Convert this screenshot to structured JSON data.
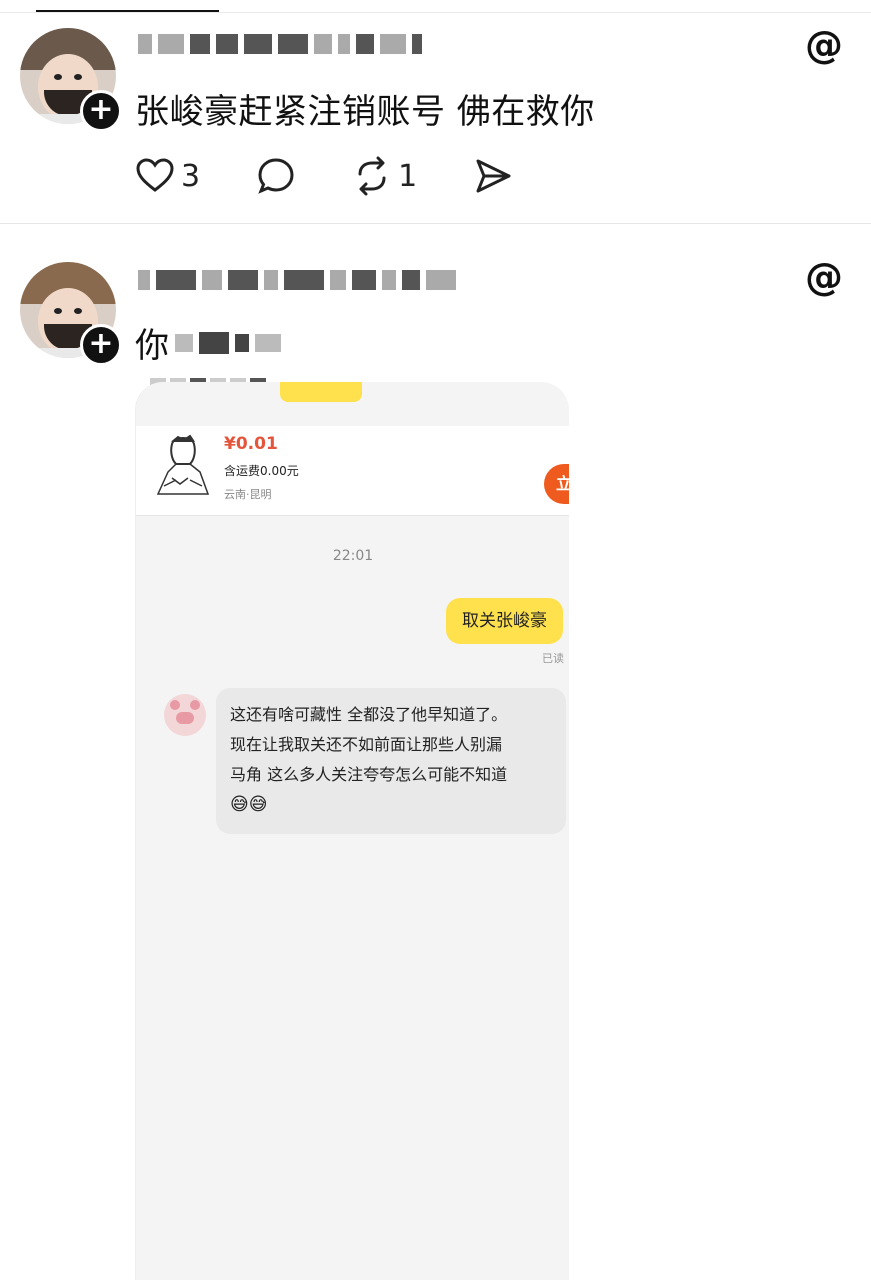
{
  "posts": [
    {
      "text": "张峻豪赶紧注销账号 佛在救你",
      "follow_symbol": "+",
      "threads_glyph": "@",
      "likes": "3",
      "reposts": "1"
    },
    {
      "text_visible": "你",
      "follow_symbol": "+",
      "threads_glyph": "@",
      "screenshot": {
        "product_price": "¥0.01",
        "shipping": "含运费0.00元",
        "location": "云南·昆明",
        "buy_button": "立",
        "time": "22:01",
        "my_message": "取关张峻豪",
        "read_status": "已读",
        "reply_lines": [
          "这还有啥可藏性 全都没了他早知道了。",
          "现在让我取关还不如前面让那些人别漏",
          "马角 这么多人关注夸夸怎么可能不知道"
        ],
        "reply_emojis": "😅😅"
      }
    }
  ]
}
